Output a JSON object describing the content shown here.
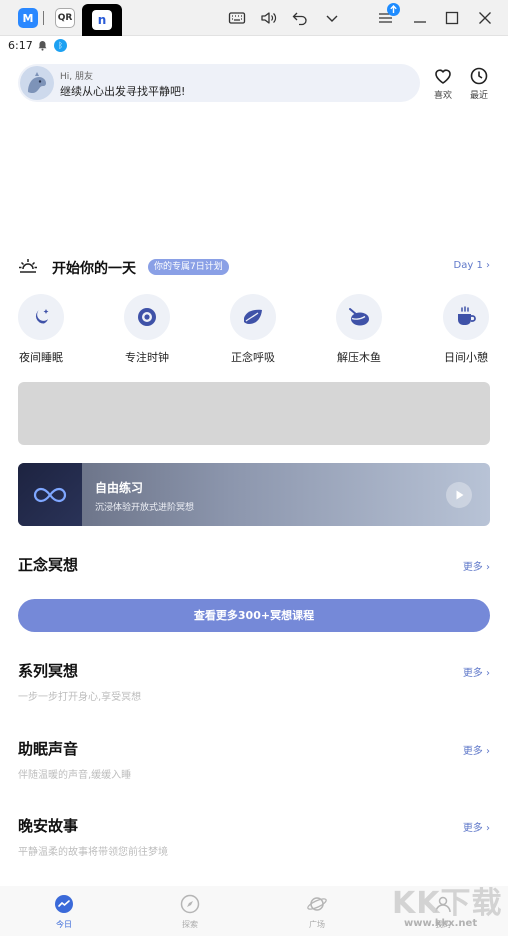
{
  "emulator": {
    "tabs": [
      "M",
      "QR",
      "n"
    ]
  },
  "status_bar": {
    "time": "6:17"
  },
  "greeting": {
    "hi": "Hi, 朋友",
    "message": "继续从心出发寻找平静吧!"
  },
  "top_actions": [
    {
      "label": "喜欢",
      "icon": "heart-icon"
    },
    {
      "label": "最近",
      "icon": "clock-icon"
    }
  ],
  "day_plan": {
    "title": "开始你的一天",
    "badge": "你的专属7日计划",
    "link": "Day 1"
  },
  "quick_actions": [
    {
      "label": "夜间睡眠",
      "icon": "moon-star-icon"
    },
    {
      "label": "专注时钟",
      "icon": "focus-target-icon"
    },
    {
      "label": "正念呼吸",
      "icon": "leaf-icon"
    },
    {
      "label": "解压木鱼",
      "icon": "wooden-fish-icon"
    },
    {
      "label": "日间小憩",
      "icon": "coffee-cup-icon"
    }
  ],
  "free_practice": {
    "title": "自由练习",
    "subtitle": "沉浸体验开放式进阶冥想"
  },
  "sections": {
    "mindfulness": {
      "title": "正念冥想",
      "more": "更多"
    },
    "cta": "查看更多300+冥想课程",
    "series": {
      "title": "系列冥想",
      "desc": "一步一步打开身心,享受冥想",
      "more": "更多"
    },
    "sleep_sounds": {
      "title": "助眠声音",
      "desc": "伴随温暖的声音,缓缓入睡",
      "more": "更多"
    },
    "bedtime_stories": {
      "title": "晚安故事",
      "desc": "平静温柔的故事将带领您前往梦境",
      "more": "更多"
    }
  },
  "bottom_nav": [
    {
      "label": "今日",
      "icon": "today-icon",
      "active": true
    },
    {
      "label": "探索",
      "icon": "compass-icon",
      "active": false
    },
    {
      "label": "广场",
      "icon": "planet-icon",
      "active": false
    },
    {
      "label": "我的",
      "icon": "profile-icon",
      "active": false
    }
  ],
  "watermark": {
    "main": "KK下载",
    "url": "www.kkx.net"
  },
  "colors": {
    "accent": "#7589d8",
    "link": "#5f78c9",
    "nav_active": "#3b6ad9"
  }
}
